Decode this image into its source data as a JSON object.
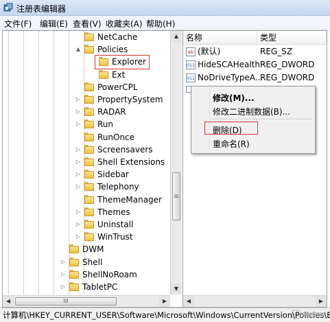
{
  "window": {
    "title": "注册表编辑器"
  },
  "menu": [
    "文件(F)",
    "编辑(E)",
    "查看(V)",
    "收藏夹(A)",
    "帮助(H)"
  ],
  "tree": [
    {
      "label": "NetCache",
      "expander": ""
    },
    {
      "label": "Policies",
      "expander": "▲"
    },
    {
      "label": "Explorer",
      "expander": ""
    },
    {
      "label": "Ext",
      "expander": ""
    },
    {
      "label": "PowerCPL",
      "expander": ""
    },
    {
      "label": "PropertySystem",
      "expander": "▷"
    },
    {
      "label": "RADAR",
      "expander": "▷"
    },
    {
      "label": "Run",
      "expander": "▷"
    },
    {
      "label": "RunOnce",
      "expander": ""
    },
    {
      "label": "Screensavers",
      "expander": "▷"
    },
    {
      "label": "Shell Extensions",
      "expander": "▷"
    },
    {
      "label": "Sidebar",
      "expander": "▷"
    },
    {
      "label": "Telephony",
      "expander": "▷"
    },
    {
      "label": "ThemeManager",
      "expander": ""
    },
    {
      "label": "Themes",
      "expander": "▷"
    },
    {
      "label": "Uninstall",
      "expander": "▷"
    },
    {
      "label": "WinTrust",
      "expander": "▷"
    },
    {
      "label": "DWM",
      "expander": ""
    },
    {
      "label": "Shell",
      "expander": "▷"
    },
    {
      "label": "ShellNoRoam",
      "expander": "▷"
    },
    {
      "label": "TabletPC",
      "expander": "▷"
    }
  ],
  "columns": {
    "name": "名称",
    "type": "类型"
  },
  "values": [
    {
      "name": "(默认)",
      "type": "REG_SZ",
      "icon": "ab"
    },
    {
      "name": "HideSCAHealth",
      "type": "REG_DWORD",
      "icon": "011"
    },
    {
      "name": "NoDriveTypeA...",
      "type": "REG_DWORD",
      "icon": "011"
    }
  ],
  "context_menu": {
    "modify": "修改(M)...",
    "modify_binary": "修改二进制数据(B)...",
    "delete": "删除(D)",
    "rename": "重命名(R)"
  },
  "status": {
    "path": "计算机\\HKEY_CURRENT_USER\\Software\\Microsoft\\Windows\\CurrentVersion\\Policies\\Explo"
  },
  "scroll": {
    "thumb_grip": "≡",
    "h_grip": "III",
    "up": "▲",
    "down": "▼",
    "left": "◀",
    "right": "▶"
  },
  "colors": {
    "selection": "#3399ff",
    "highlight_box": "#e03030"
  }
}
